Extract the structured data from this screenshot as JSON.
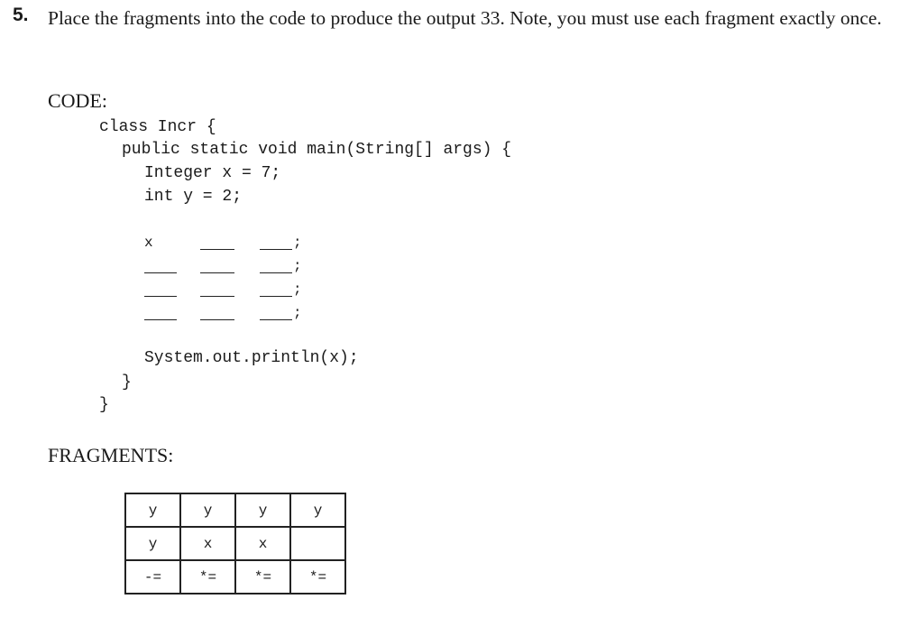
{
  "question": {
    "number": "5.",
    "text": "Place the fragments into the code to produce the output 33. Note, you must use each fragment exactly once."
  },
  "code_section": {
    "heading": "CODE:",
    "lines": {
      "class_decl": "class Incr {",
      "main_decl": "public static void main(String[] args) {",
      "decl_x": "Integer x = 7;",
      "decl_y": "int y = 2;",
      "slot_prefix": "x",
      "semicolon": ";",
      "println": "System.out.println(x);",
      "close_inner": "}",
      "close_outer": "}"
    }
  },
  "fragments_section": {
    "heading": "FRAGMENTS:",
    "rows": [
      [
        "y",
        "y",
        "y",
        "y"
      ],
      [
        "y",
        "x",
        "x",
        ""
      ],
      [
        "-=",
        "*=",
        "*=",
        "*="
      ]
    ]
  }
}
